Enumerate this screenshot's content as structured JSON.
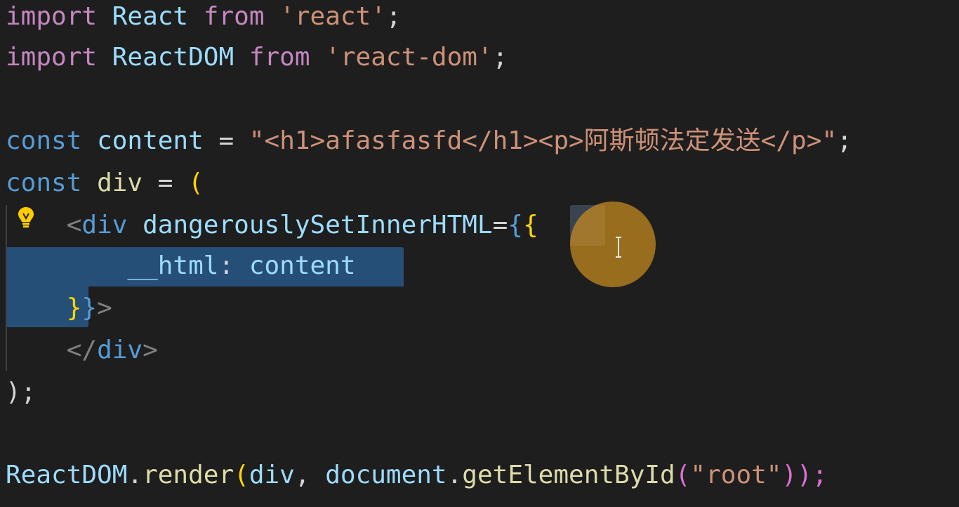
{
  "editor": {
    "lines": {
      "l1": {
        "kw_import": "import",
        "name": "React",
        "kw_from": "from",
        "source": "'react'",
        "end": ";"
      },
      "l2": {
        "kw_import": "import",
        "name": "ReactDOM",
        "kw_from": "from",
        "source": "'react-dom'",
        "end": ";"
      },
      "l4": {
        "kw_const": "const",
        "name": "content",
        "op": "=",
        "value": "\"<h1>afasfasfd</h1><p>阿斯顿法定发送</p>\"",
        "end": ";"
      },
      "l5": {
        "kw_const": "const",
        "name": "div",
        "op": "=",
        "paren": "("
      },
      "l6": {
        "lt": "<",
        "tag": "div",
        "attr": "dangerouslySetInnerHTML",
        "eq": "=",
        "brace_outer": "{",
        "brace_inner": "{"
      },
      "l7": {
        "key": "__html",
        "colon": ":",
        "value": "content"
      },
      "l8": {
        "brace_inner": "}",
        "brace_outer": "}",
        "gt": ">"
      },
      "l9": {
        "lt": "</",
        "tag": "div",
        "gt": ">"
      },
      "l10": {
        "text": ");"
      },
      "l12": {
        "obj": "ReactDOM",
        "dot1": ".",
        "fn": "render",
        "open": "(",
        "arg1": "div",
        "comma": ",",
        "obj2": "document",
        "dot2": ".",
        "fn2": "getElementById",
        "open2": "(",
        "arg2": "\"root\"",
        "close": "));"
      }
    }
  },
  "icons": {
    "lightbulb": "lightbulb-icon",
    "text_cursor": "text-cursor-icon"
  },
  "colors": {
    "background": "#1e1e1e",
    "keyword_control": "#c586c0",
    "keyword_storage": "#569cd6",
    "variable": "#9cdcfe",
    "type": "#4ec9b0",
    "function": "#dcdcaa",
    "string": "#ce9178",
    "selection": "#264f78",
    "bracket_gold": "#ffd700",
    "bracket_orchid": "#da70d6",
    "lightbulb": "#ffcc00"
  }
}
